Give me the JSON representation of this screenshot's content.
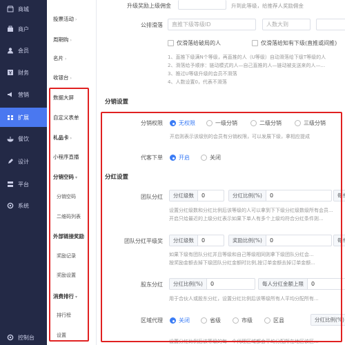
{
  "sidebar": {
    "items": [
      {
        "label": "商城",
        "icon": "shop-icon"
      },
      {
        "label": "商户",
        "icon": "merchant-icon"
      },
      {
        "label": "会员",
        "icon": "member-icon"
      },
      {
        "label": "财务",
        "icon": "finance-icon"
      },
      {
        "label": "营销",
        "icon": "marketing-icon"
      },
      {
        "label": "扩展",
        "icon": "extension-icon",
        "active": true
      },
      {
        "label": "餐饮",
        "icon": "catering-icon"
      },
      {
        "label": "设计",
        "icon": "design-icon"
      },
      {
        "label": "平台",
        "icon": "platform-icon"
      },
      {
        "label": "系统",
        "icon": "system-icon"
      }
    ],
    "bottom": {
      "label": "控制台",
      "icon": "console-icon"
    }
  },
  "subnav": {
    "collapse": "«",
    "top_items": [
      "投票活动",
      "周期购",
      "名片",
      "收银台"
    ],
    "groups": [
      {
        "label": "数据大屏"
      },
      {
        "label": "自定义表单"
      },
      {
        "label": "礼品卡"
      },
      {
        "label": "小程序直播"
      },
      {
        "label": "分销空码",
        "children": [
          "分销空码",
          "二维码列表"
        ]
      },
      {
        "label": "外部链接奖励",
        "children": [
          "奖励记录",
          "奖励设置"
        ]
      },
      {
        "label": "消费排行",
        "children": [
          "排行榜",
          "设置"
        ]
      }
    ]
  },
  "top": {
    "upgrade_label": "升级奖励上级佣金",
    "upgrade_hint": "升到此等级，给推荐人奖励佣金",
    "slide_label": "公排滑落",
    "slide_input": "直推下级等级ID",
    "slide_count": "人数大到",
    "check1": "仅滑落给破局的人",
    "check2": "仅滑落给知有下级(直推或间推)",
    "notes": [
      "1、直推下级满N个等级，再直推的人（U等级）自动滑落给下级T等级的人",
      "2、滑落给予顺序：链动模式的人—自己直推的人—链动被支送来的人—...",
      "3、推过U等级升级的会员不滑落",
      "4、人数设置0，代表不滑落"
    ]
  },
  "distribution": {
    "section_title": "分销设置",
    "permission_label": "分销权限",
    "permission_options": [
      "无权限",
      "一级分销",
      "二级分销",
      "三级分销"
    ],
    "permission_selected": 0,
    "permission_hint": "开启则表示该级别的会员有分销权限，可以发展下级，拿相应提成",
    "proxy_label": "代客下单",
    "proxy_options": [
      "开启",
      "关闭"
    ],
    "proxy_selected": 0
  },
  "dividend": {
    "section_title": "分红设置",
    "team_label": "团队分红",
    "team_level_prefix": "分红级数",
    "team_level_value": "0",
    "team_ratio_prefix": "分红比例(%)",
    "team_ratio_value": "0",
    "team_extra_prefix": "每单",
    "team_hint1": "设置分红级数和分红比例后该等级的人可以拿到下下级分红级数级所有会员...",
    "team_hint2": "开启只给最近的上级分红表示如果下单人有多个上级均符合分红条件则...",
    "flat_label": "团队分红平级奖",
    "flat_level_prefix": "分红级数",
    "flat_level_value": "0",
    "flat_reward_prefix": "奖励比例(%)",
    "flat_reward_value": "0",
    "flat_extra_prefix": "每单",
    "flat_hint1": "如果下级有团队分红并且等级和自己等级相同则拿下级团队分红会...",
    "flat_hint2": "按奖励金额去掉下级团队分红金额时比例,按订单金额去掉订单金额...",
    "shareholder_label": "股东分红",
    "shareholder_ratio_prefix": "分红比例(%)",
    "shareholder_ratio_value": "0",
    "shareholder_cap_prefix": "每人分红金额上限",
    "shareholder_cap_value": "0",
    "shareholder_hint": "用于合伙人或股东分红，设置分红比例后该等级所有人平均分配所有...",
    "region_label": "区域代理",
    "region_options": [
      "关闭",
      "省级",
      "市级",
      "区县"
    ],
    "region_selected": 0,
    "region_ratio_prefix": "分红比例(%)",
    "region_hint": "设置分红比例后该等级的每一个代理区域都会平均分配所在地区该区..."
  }
}
